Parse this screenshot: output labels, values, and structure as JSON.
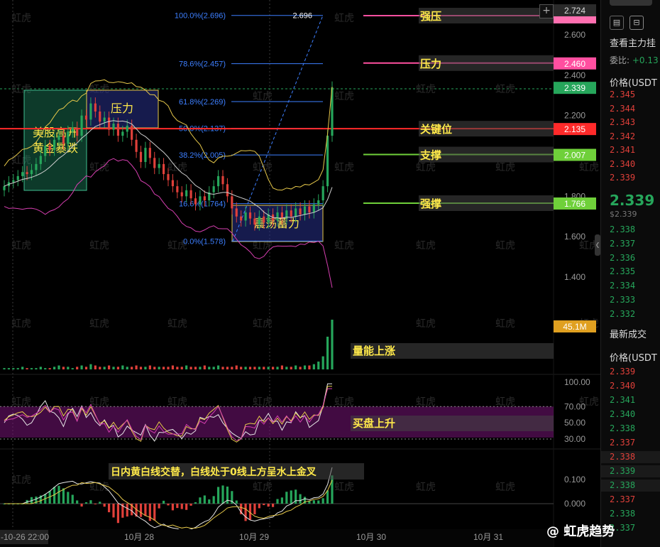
{
  "chart_data": [
    {
      "type": "candlestick",
      "x_ticks": [
        "-10-26 22:00",
        "10月 28",
        "10月 29",
        "10月 30",
        "10月 31"
      ],
      "y_ticks": [
        1.4,
        1.6,
        1.8,
        2.0,
        2.2,
        2.4,
        2.6
      ],
      "ylim": [
        1.3,
        2.74
      ],
      "close_series": [
        1.85,
        1.87,
        1.88,
        1.9,
        1.92,
        1.91,
        1.93,
        1.96,
        2.0,
        2.05,
        2.03,
        2.08,
        2.1,
        2.06,
        2.12,
        2.14,
        2.1,
        2.2,
        2.18,
        2.26,
        2.22,
        2.17,
        2.19,
        2.13,
        2.16,
        2.1,
        2.12,
        2.15,
        2.08,
        2.02,
        1.97,
        2.04,
        1.99,
        1.94,
        1.96,
        1.91,
        1.88,
        1.85,
        1.82,
        1.8,
        1.83,
        1.79,
        1.76,
        1.8,
        1.78,
        1.82,
        1.85,
        1.9,
        1.86,
        1.8,
        1.74,
        1.7,
        1.68,
        1.72,
        1.69,
        1.66,
        1.7,
        1.67,
        1.71,
        1.68,
        1.72,
        1.69,
        1.73,
        1.7,
        1.74,
        1.71,
        1.75,
        1.72,
        1.76,
        1.78,
        1.85,
        2.1,
        2.339
      ],
      "fibonacci": [
        {
          "label": "100.0%(2.696)",
          "value": 2.696
        },
        {
          "label": "78.6%(2.457)",
          "value": 2.457
        },
        {
          "label": "61.8%(2.269)",
          "value": 2.269
        },
        {
          "label": "50.0%(2.137)",
          "value": 2.137
        },
        {
          "label": "38.2%(2.005)",
          "value": 2.005
        },
        {
          "label": "16.6%(1.764)",
          "value": 1.764
        },
        {
          "label": "0.0%(1.578)",
          "value": 1.578
        }
      ],
      "peak_label": "2.696",
      "levels": [
        {
          "name": "强压",
          "value": 2.724,
          "tag": "2.724",
          "color": "#ff4fa0"
        },
        {
          "name": "压力",
          "value": 2.46,
          "tag": "2.460",
          "color": "#ff4fa0"
        },
        {
          "name": "current",
          "value": 2.339,
          "tag": "2.339",
          "color": "#26a65b"
        },
        {
          "name": "关键位",
          "value": 2.135,
          "tag": "2.135",
          "color": "#ff2a2a"
        },
        {
          "name": "支撑",
          "value": 2.007,
          "tag": "2.007",
          "color": "#6fd03a"
        },
        {
          "name": "强撑",
          "value": 1.766,
          "tag": "1.766",
          "color": "#6fd03a"
        }
      ],
      "annotations": [
        "美股高开",
        "黄金暴跌",
        "压力",
        "震荡蓄力"
      ]
    },
    {
      "type": "bar",
      "name": "volume",
      "latest_tag": "45.1M",
      "annotation": "量能上涨",
      "values": [
        1,
        1,
        1,
        1,
        2,
        1,
        1,
        1,
        2,
        1,
        1,
        2,
        3,
        2,
        2,
        1,
        2,
        3,
        2,
        4,
        3,
        2,
        2,
        3,
        2,
        2,
        3,
        2,
        2,
        3,
        2,
        2,
        3,
        2,
        2,
        2,
        2,
        3,
        2,
        2,
        3,
        2,
        2,
        2,
        3,
        2,
        2,
        3,
        2,
        2,
        2,
        3,
        2,
        2,
        2,
        2,
        2,
        2,
        2,
        2,
        2,
        3,
        2,
        2,
        3,
        2,
        3,
        3,
        4,
        6,
        10,
        25,
        38
      ]
    },
    {
      "type": "line",
      "name": "oscillator",
      "y_ticks": [
        30.0,
        50.0,
        70.0,
        100.0
      ],
      "ylim": [
        20,
        100
      ],
      "annotation": "买盘上升"
    },
    {
      "type": "bar",
      "name": "macd",
      "y_ticks": [
        0.0,
        0.1
      ],
      "annotation": "日内黄白线交替，白线处于0线上方呈水上金叉"
    }
  ],
  "sidebar": {
    "title": "查看主力挂",
    "ratio_label": "委比:",
    "ratio_value": "+0.13",
    "price_head": "价格(USDT",
    "asks": [
      "2.345",
      "2.344",
      "2.343",
      "2.342",
      "2.341",
      "2.340",
      "2.339"
    ],
    "last_price": "2.339",
    "last_price_sub": "$2.339",
    "bids": [
      "2.338",
      "2.337",
      "2.336",
      "2.335",
      "2.334",
      "2.333",
      "2.332"
    ],
    "trades_title": "最新成交",
    "trades_head": "价格(USDT",
    "trades": [
      {
        "p": "2.339",
        "side": "sell"
      },
      {
        "p": "2.340",
        "side": "sell"
      },
      {
        "p": "2.341",
        "side": "buy"
      },
      {
        "p": "2.340",
        "side": "buy"
      },
      {
        "p": "2.338",
        "side": "buy"
      },
      {
        "p": "2.337",
        "side": "sell"
      },
      {
        "p": "2.338",
        "side": "sell"
      },
      {
        "p": "2.339",
        "side": "buy"
      },
      {
        "p": "2.338",
        "side": "buy"
      },
      {
        "p": "2.337",
        "side": "sell"
      },
      {
        "p": "2.338",
        "side": "buy"
      },
      {
        "p": "2.337",
        "side": "buy"
      }
    ]
  },
  "watermark": "虹虎",
  "brand": "@ 虹虎趋势"
}
